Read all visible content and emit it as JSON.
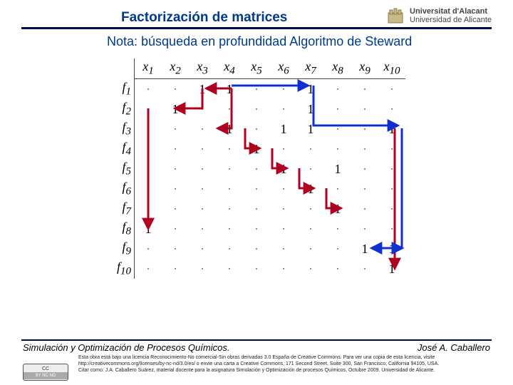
{
  "header": {
    "title": "Factorización de matrices",
    "university_line1": "Universitat d'Alacant",
    "university_line2": "Universidad de Alicante"
  },
  "subtitle": "Nota: búsqueda en profundidad Algoritmo de Steward",
  "footer": {
    "left": "Simulación y Optimización de Procesos Químicos.",
    "right": "José A. Caballero",
    "license_l1": "Esta obra está bajo una licencia Reconocimiento-No comercial-Sin obras derivadas 3.0 España de Creative Commons. Para ver una copia de esta licencia, visite",
    "license_l2": "http://creativecommons.org/licenses/by-nc-nd/3.0/es/ o envie una carta a Creative Commons, 171 Second Street, Suite 300, San Francisco, California 94105, USA.",
    "license_l3": "Citar como: J.A. Caballero Suárez, material docente para la asignatura Simulación y Optimización de procesos Químicos, Octubre 2009. Universidad de Alicante.",
    "cc_label": "CC",
    "cc_tags": "BY  NC  ND"
  },
  "chart_data": {
    "type": "table",
    "title": "Incidence matrix f_i vs x_j (1 = nonzero entry, · = zero)",
    "col_headers": [
      "x1",
      "x2",
      "x3",
      "x4",
      "x5",
      "x6",
      "x7",
      "x8",
      "x9",
      "x10"
    ],
    "row_headers": [
      "f1",
      "f2",
      "f3",
      "f4",
      "f5",
      "f6",
      "f7",
      "f8",
      "f9",
      "f10"
    ],
    "matrix": [
      [
        "·",
        "·",
        "1",
        "1",
        "·",
        "·",
        "1",
        "·",
        "·",
        "·"
      ],
      [
        "·",
        "1",
        "·",
        "·",
        "·",
        "·",
        "1",
        "·",
        "·",
        "·"
      ],
      [
        "·",
        "·",
        "·",
        "1",
        "·",
        "1",
        "1",
        "·",
        "·",
        "1"
      ],
      [
        "·",
        "·",
        "·",
        "·",
        "1",
        "·",
        "·",
        "·",
        "·",
        "·"
      ],
      [
        "·",
        "·",
        "·",
        "·",
        "·",
        "1",
        "·",
        "1",
        "·",
        "·"
      ],
      [
        "·",
        "·",
        "·",
        "·",
        "·",
        "·",
        "1",
        "·",
        "·",
        "·"
      ],
      [
        "·",
        "·",
        "·",
        "·",
        "·",
        "·",
        "·",
        "1",
        "·",
        "·"
      ],
      [
        "1",
        "·",
        "·",
        "·",
        "·",
        "·",
        "·",
        "·",
        "·",
        "·"
      ],
      [
        "·",
        "·",
        "·",
        "·",
        "·",
        "·",
        "·",
        "·",
        "1",
        "1"
      ],
      [
        "·",
        "·",
        "·",
        "·",
        "·",
        "·",
        "·",
        "·",
        "·",
        "1"
      ]
    ],
    "path_red_sequence": [
      "(f1,x4)",
      "(f1,x3)",
      "(f2,x2)",
      "(f4,x5)",
      "(f3,x4)",
      "(f5,x6)",
      "(f6,x7)",
      "(f7,x8)",
      "(f8,x1)",
      "(f10,x10)"
    ],
    "path_blue_sequence": [
      "(f1,x7)",
      "(f3,x10)",
      "(f9,x9)",
      "(f9,x10)"
    ]
  }
}
